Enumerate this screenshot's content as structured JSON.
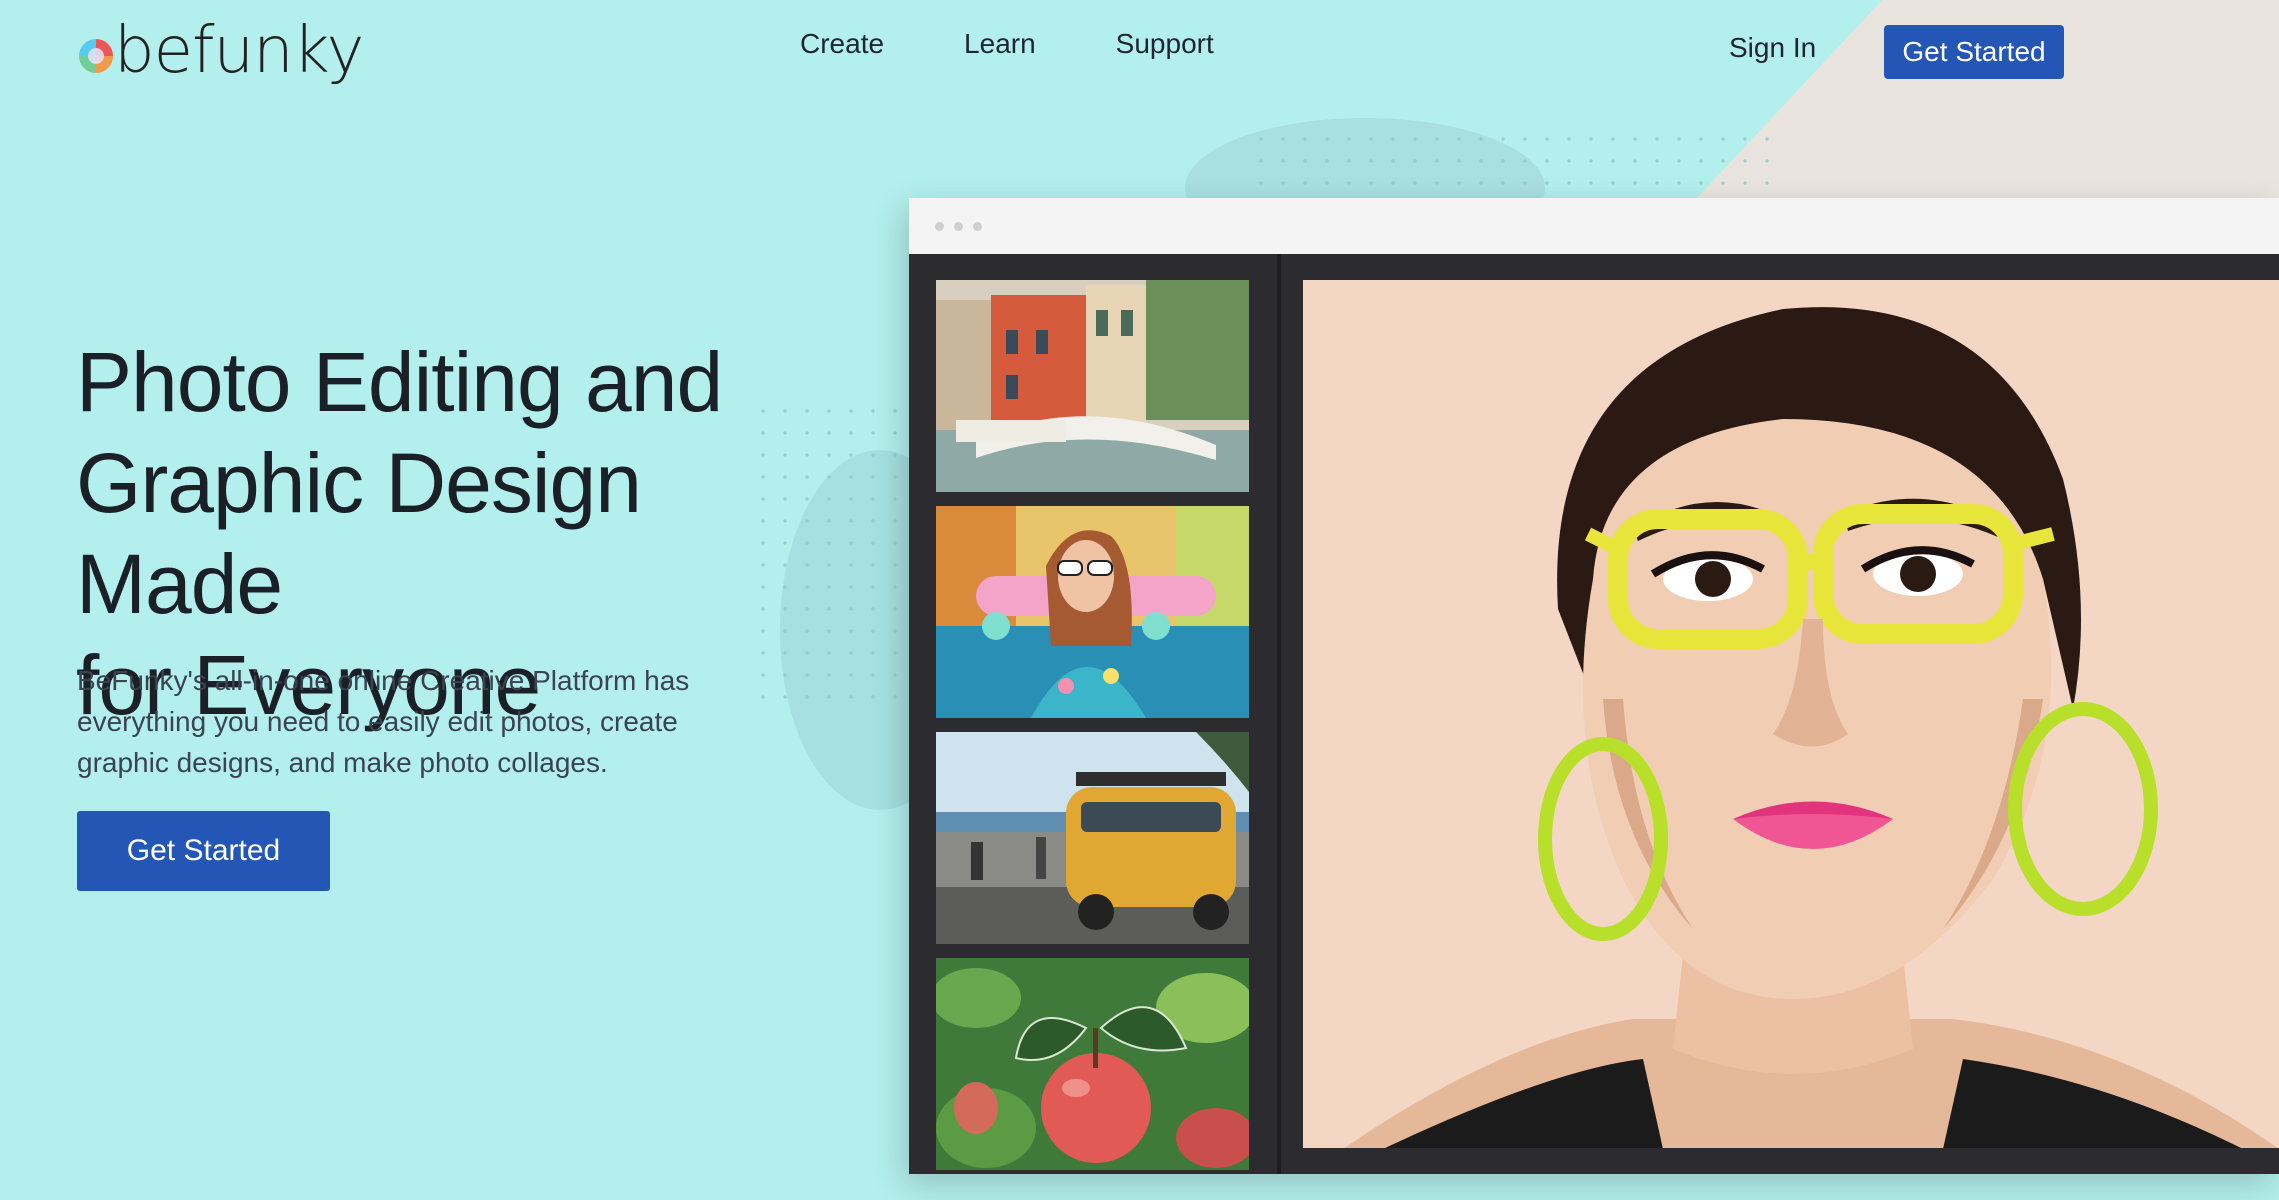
{
  "header": {
    "logo_text": "befunky",
    "nav": [
      "Create",
      "Learn",
      "Support"
    ],
    "sign_in": "Sign In",
    "cta": "Get Started"
  },
  "hero": {
    "title_lines": [
      "Photo Editing and",
      "Graphic Design Made",
      "for Everyone"
    ],
    "description": "BeFunky's all-in-one online Creative Platform has everything you need to easily edit photos, create graphic designs, and make photo collages.",
    "cta": "Get Started"
  },
  "mockup": {
    "thumbnails": [
      "venice-canal-photo",
      "girl-with-skateboard-photo",
      "yellow-van-beach-photo",
      "apple-on-tree-photo"
    ],
    "main_image": "woman-yellow-glasses-cartoon-photo"
  },
  "colors": {
    "background": "#b3efec",
    "accent": "#2456b6",
    "mock_dark": "#2b2b30"
  }
}
